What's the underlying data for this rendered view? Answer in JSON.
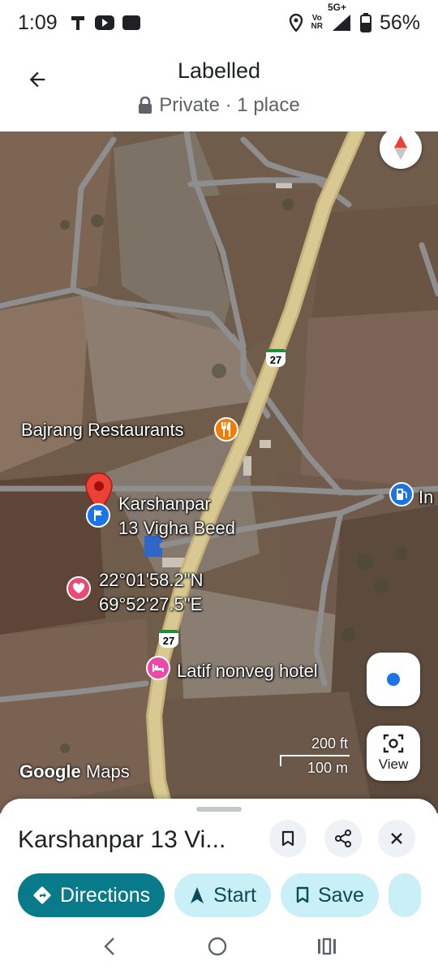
{
  "status_bar": {
    "time": "1:09",
    "network_top": "Vo",
    "network_bottom": "NR",
    "signal_label": "5G+",
    "battery": "56%"
  },
  "header": {
    "title": "Labelled",
    "subtitle": "Private · 1 place"
  },
  "map": {
    "labels": {
      "restaurant": "Bajrang Restaurants",
      "place_line1": "Karshanpar",
      "place_line2": "13 Vigha Beed",
      "coord_line1": "22°01'58.2\"N",
      "coord_line2": "69°52'27.5\"E",
      "hotel": "Latif nonveg hotel",
      "fuel_partial": "In",
      "highway_top": "27",
      "highway_bottom": "27"
    },
    "scale": {
      "imperial": "200 ft",
      "metric": "100 m"
    },
    "logo": {
      "bold": "Google",
      "rest": "Maps"
    },
    "view_button": "View"
  },
  "sheet": {
    "title": "Karshanpar 13 Vi...",
    "actions": {
      "directions": "Directions",
      "start": "Start",
      "save": "Save"
    }
  },
  "colors": {
    "primary_chip": "#087a8a",
    "tonal_chip": "#c9f0f6",
    "marker_red": "#ea4335",
    "poi_orange": "#f57c00",
    "poi_pink": "#ec4aa8",
    "poi_blue": "#1a73e8"
  }
}
